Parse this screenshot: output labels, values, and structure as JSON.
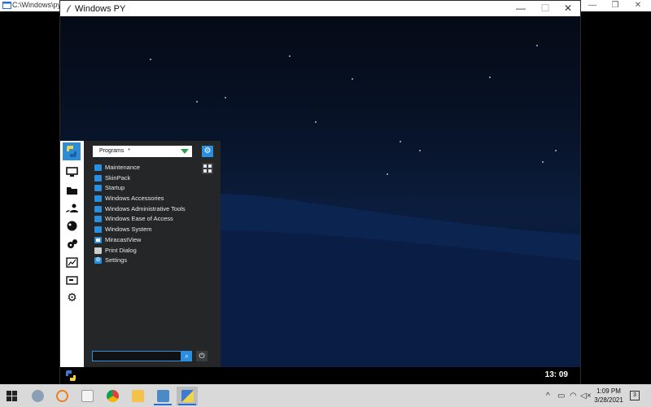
{
  "outer_window": {
    "title": "C:\\Windows\\py.e",
    "minimize": "—",
    "maximize": "❐",
    "close": "✕"
  },
  "window": {
    "title": "Windows PY",
    "minimize": "—",
    "maximize": "☐",
    "close": "✕"
  },
  "start_menu": {
    "programs_select": "Programs",
    "programs_marker": "*",
    "gear_glyph": "⚙",
    "items": [
      {
        "label": "Maintenance",
        "icon": "folder-icon"
      },
      {
        "label": "SkinPack",
        "icon": "folder-icon"
      },
      {
        "label": "Startup",
        "icon": "folder-icon"
      },
      {
        "label": "Windows Accessories",
        "icon": "folder-icon"
      },
      {
        "label": "Windows Administrative Tools",
        "icon": "folder-icon"
      },
      {
        "label": "Windows Ease of Access",
        "icon": "folder-icon"
      },
      {
        "label": "Windows System",
        "icon": "folder-icon"
      },
      {
        "label": "MiracastView",
        "icon": "app-icon"
      },
      {
        "label": "Print Dialog",
        "icon": "printer-icon"
      },
      {
        "label": "Settings",
        "icon": "gear-icon"
      }
    ],
    "search_placeholder": "",
    "search_glyph": "⌕",
    "power_glyph": "⏻"
  },
  "app_taskbar": {
    "clock": "13: 09"
  },
  "taskbar": {
    "time": "1:09 PM",
    "date": "3/28/2021",
    "notifications_count": "3",
    "tray_chevron": "^"
  },
  "colors": {
    "accent": "#2a8fe0",
    "menu_bg": "#252628",
    "desktop": "#0b1d3d"
  }
}
